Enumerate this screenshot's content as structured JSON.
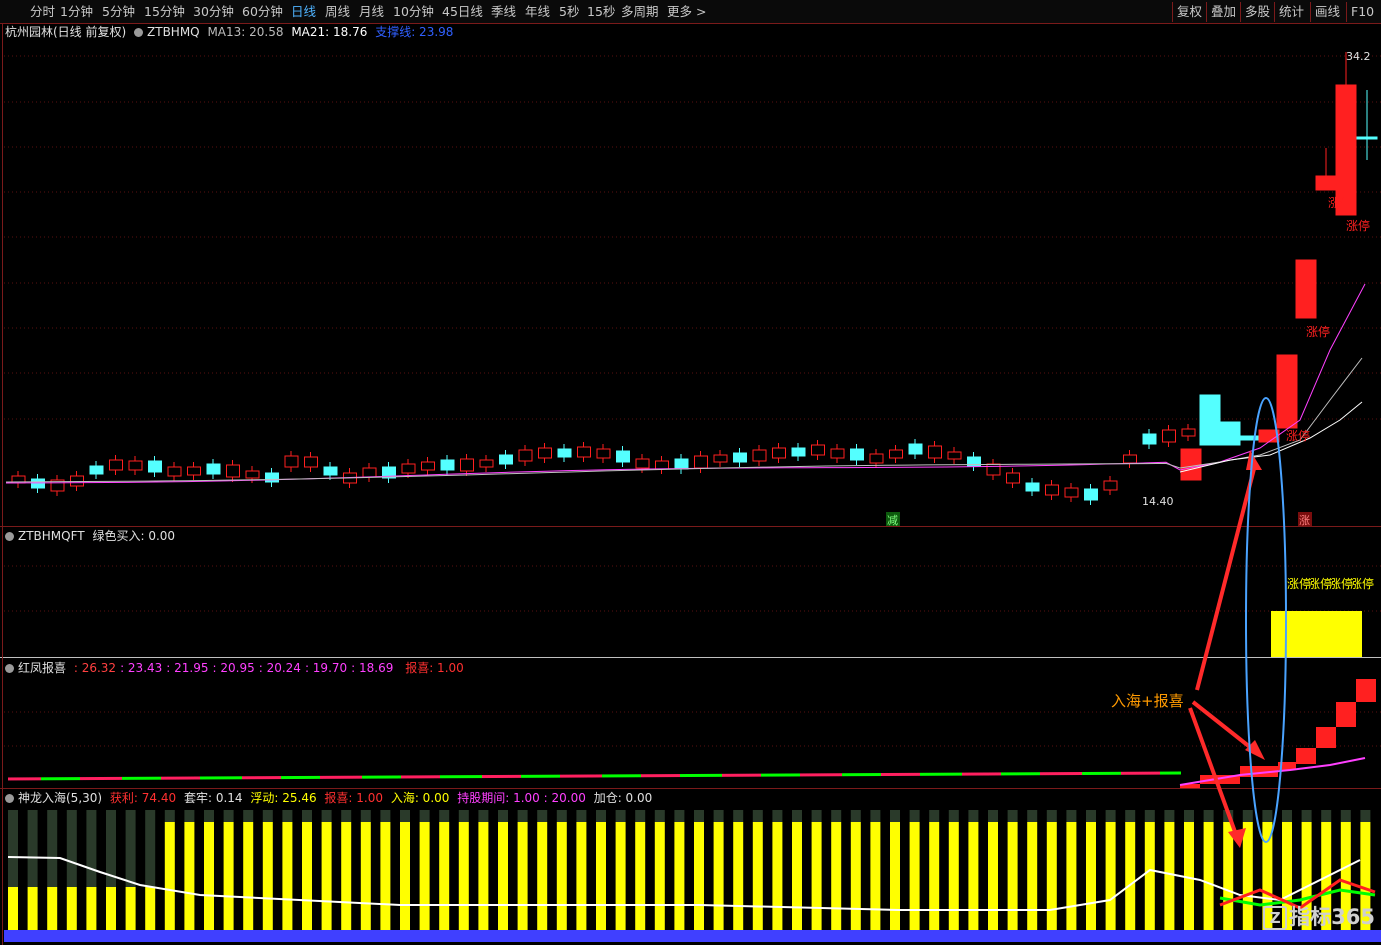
{
  "toolbar": {
    "periods": [
      "分时",
      "1分钟",
      "5分钟",
      "15分钟",
      "30分钟",
      "60分钟",
      "日线",
      "周线",
      "月线",
      "10分钟",
      "45日线",
      "季线",
      "年线",
      "5秒",
      "15秒",
      "多周期",
      "更多 >"
    ],
    "active_index": 6,
    "right_buttons": [
      "复权",
      "叠加",
      "多股",
      "统计",
      "画线",
      "F10"
    ]
  },
  "main_panel": {
    "stock": "杭州园林(日线 前复权)",
    "indicator": "ZTBHMQ",
    "ma13": "MA13: 20.58",
    "ma21": "MA21: 18.76",
    "line3": "支撑线: 23.98",
    "high_label": "34.2",
    "low_label": "14.40",
    "limit_up_label": "涨停",
    "marker_jian": "减",
    "marker_zhang": "涨"
  },
  "panel2": {
    "title": "ZTBHMQFT",
    "value": "绿色买入: 0.00",
    "labels": [
      "涨停",
      "涨停",
      "涨停",
      "涨停"
    ]
  },
  "panel3": {
    "title": "红凤报喜",
    "values": [
      ": 26.32",
      ": 23.43",
      ": 21.95",
      ": 20.95",
      ": 20.24",
      ": 19.70",
      ": 18.69"
    ],
    "baoxi": "报喜: 1.00"
  },
  "panel4": {
    "title": "神龙入海(5,30)",
    "huoli": "获利: 74.40",
    "taolao": "套牢: 0.14",
    "fudong": "浮动: 25.46",
    "baoxi": "报喜: 1.00",
    "ruhai": "入海: 0.00",
    "chigu": "持股期间: 1.00",
    "chigu2": ": 20.00",
    "jiacang": "加仓: 0.00"
  },
  "annotation": "入海+报喜",
  "watermark": "指标365",
  "watermark_mark": "Z",
  "colors": {
    "up": "#ff2020",
    "down": "#54ffff",
    "ma13": "#ff40ff",
    "ma21": "#c0c0c0",
    "yellow": "#ffff00",
    "green": "#00ff00",
    "blue": "#4aa3ff",
    "border": "#7a1a1a"
  }
}
